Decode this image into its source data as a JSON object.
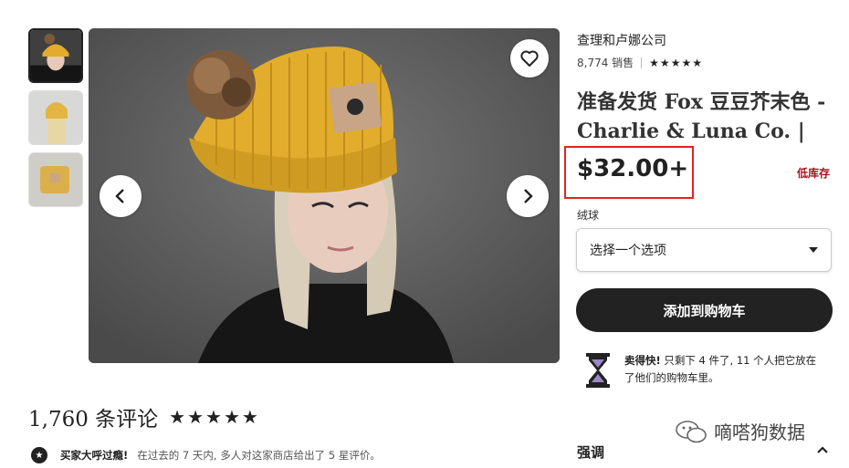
{
  "thumbnails": [
    {
      "label": "model wearing yellow beanie"
    },
    {
      "label": "beanie back view"
    },
    {
      "label": "folded beanie"
    }
  ],
  "main_image": {
    "label": "woman wearing mustard knit beanie with pom"
  },
  "shop_name": "查理和卢娜公司",
  "sales_count": "8,774 销售",
  "shop_stars": "★★★★★",
  "product_title": "准备发货 Fox 豆豆芥末色 - Charlie & Luna Co. |",
  "price": "$32.00+",
  "low_stock": "低库存",
  "variation_label": "绒球",
  "select_placeholder": "选择一个选项",
  "add_to_cart": "添加到购物车",
  "sell_fast": {
    "bold": "卖得快!",
    "text": "只剩下 4 件了, 11 个人把它放在了他们的购物车里。"
  },
  "reviews": {
    "count_label": "1,760 条评论",
    "stars": "★★★★★"
  },
  "praise": {
    "bold": "买家大呼过瘾!",
    "text": "在过去的 7 天内, 多人对这家商店给出了 5 星评价。"
  },
  "highlights_label": "强调",
  "watermark": "嘀嗒狗数据",
  "colors": {
    "accent": "#222222",
    "price_box": "#e4231f",
    "low_stock": "#a0161f",
    "beanie": "#e2ad2c"
  }
}
